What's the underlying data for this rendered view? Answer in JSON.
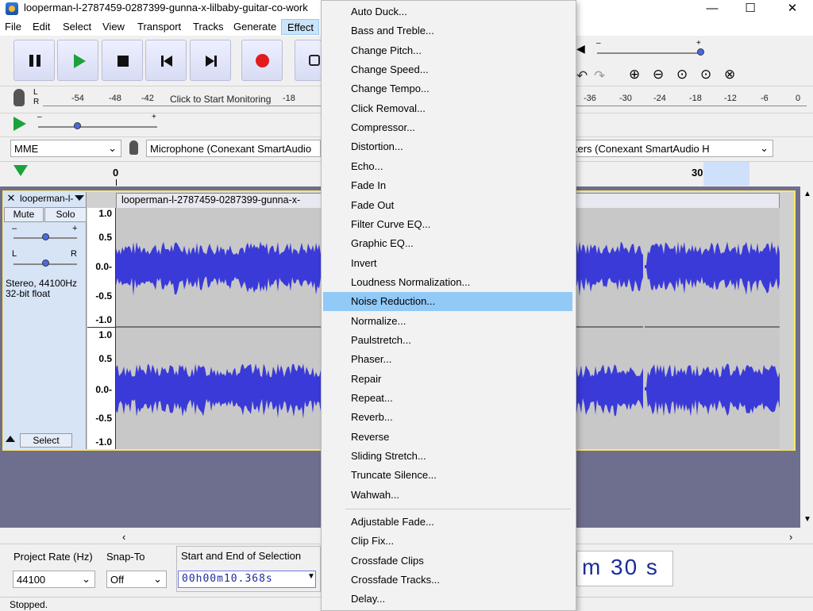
{
  "window": {
    "title": "looperman-l-2787459-0287399-gunna-x-lilbaby-guitar-co-work",
    "minimize": "—",
    "maximize": "☐",
    "close": "✕"
  },
  "menubar": {
    "items": [
      "File",
      "Edit",
      "Select",
      "View",
      "Transport",
      "Tracks",
      "Generate"
    ],
    "active": "Effect"
  },
  "record_meter": {
    "lr": "L\nR",
    "ticks": [
      "-54",
      "-48",
      "-42",
      "-18"
    ],
    "prompt": "Click to Start Monitoring"
  },
  "playback_meter": {
    "ticks": [
      "-36",
      "-30",
      "-24",
      "-18",
      "-12",
      "-6",
      "0"
    ]
  },
  "devices": {
    "host": "MME",
    "input": "Microphone (Conexant SmartAudio",
    "output": "kers (Conexant SmartAudio H"
  },
  "timeline": {
    "ticks": [
      "0",
      "30"
    ]
  },
  "track": {
    "name": "looperman-l-",
    "mute": "Mute",
    "solo": "Solo",
    "gain_minus": "–",
    "gain_plus": "+",
    "pan_l": "L",
    "pan_r": "R",
    "info1": "Stereo, 44100Hz",
    "info2": "32-bit float",
    "select": "Select",
    "clip_title": "looperman-l-2787459-0287399-gunna-x-",
    "scale": [
      "1.0",
      "0.5",
      "0.0-",
      "-0.5",
      "-1.0"
    ]
  },
  "selection_toolbar": {
    "rate_label": "Project Rate (Hz)",
    "rate_value": "44100",
    "snap_label": "Snap-To",
    "snap_value": "Off",
    "sel_label": "Start and End of Selection",
    "sel_time": "00h00m10.368s",
    "big_time_m": "m",
    "big_time_s": "30 s"
  },
  "status": "Stopped.",
  "effect_menu": {
    "items": [
      "Auto Duck...",
      "Bass and Treble...",
      "Change Pitch...",
      "Change Speed...",
      "Change Tempo...",
      "Click Removal...",
      "Compressor...",
      "Distortion...",
      "Echo...",
      "Fade In",
      "Fade Out",
      "Filter Curve EQ...",
      "Graphic EQ...",
      "Invert",
      "Loudness Normalization...",
      "Noise Reduction...",
      "Normalize...",
      "Paulstretch...",
      "Phaser...",
      "Repair",
      "Repeat...",
      "Reverb...",
      "Reverse",
      "Sliding Stretch...",
      "Truncate Silence...",
      "Wahwah..."
    ],
    "highlighted": "Noise Reduction...",
    "items2": [
      "Adjustable Fade...",
      "Clip Fix...",
      "Crossfade Clips",
      "Crossfade Tracks...",
      "Delay..."
    ]
  },
  "colors": {
    "waveform": "#3a3ad8",
    "selection_bg": "#91c9f7",
    "track_border": "#ffe66b"
  }
}
